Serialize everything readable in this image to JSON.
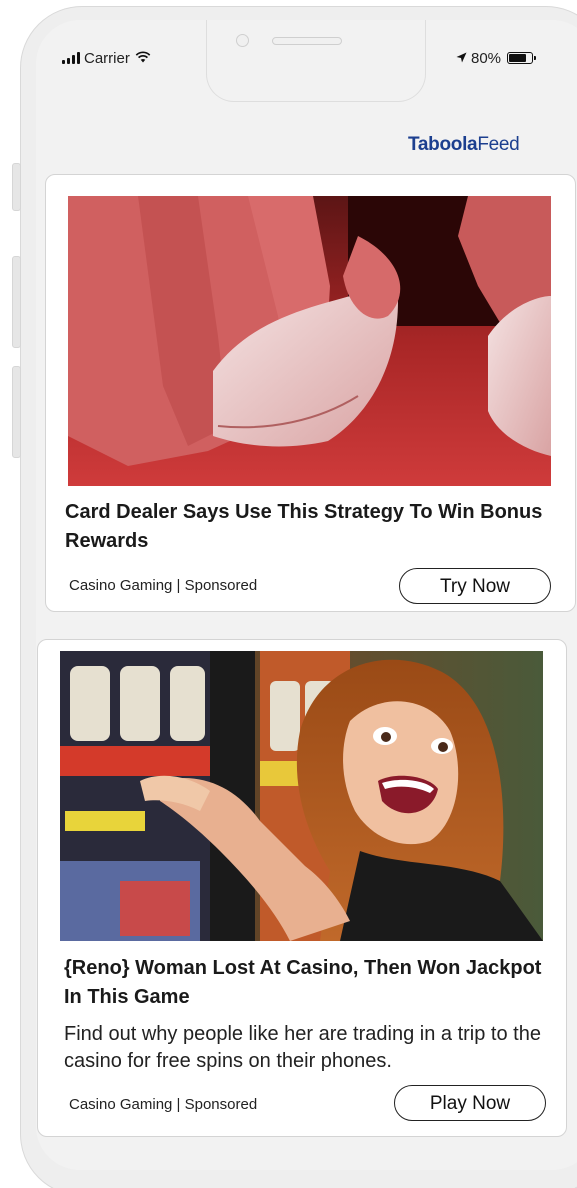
{
  "status_bar": {
    "carrier": "Carrier",
    "battery": "80%",
    "battery_level": 0.8
  },
  "feed": {
    "logo_bold": "Taboola",
    "logo_light": "Feed"
  },
  "cards": [
    {
      "headline": "Card Dealer Says Use This Strategy To Win Bonus Rewards",
      "source": "Casino Gaming | Sponsored",
      "cta": "Try Now"
    },
    {
      "headline": "{Reno} Woman Lost At Casino, Then Won Jackpot In This Game",
      "description": "Find out why people like her are trading in a trip to the casino for free spins on their phones.",
      "source": "Casino Gaming | Sponsored",
      "cta": "Play Now"
    }
  ],
  "colors": {
    "logo": "#1c3f8f",
    "frame": "#eeeeee"
  }
}
